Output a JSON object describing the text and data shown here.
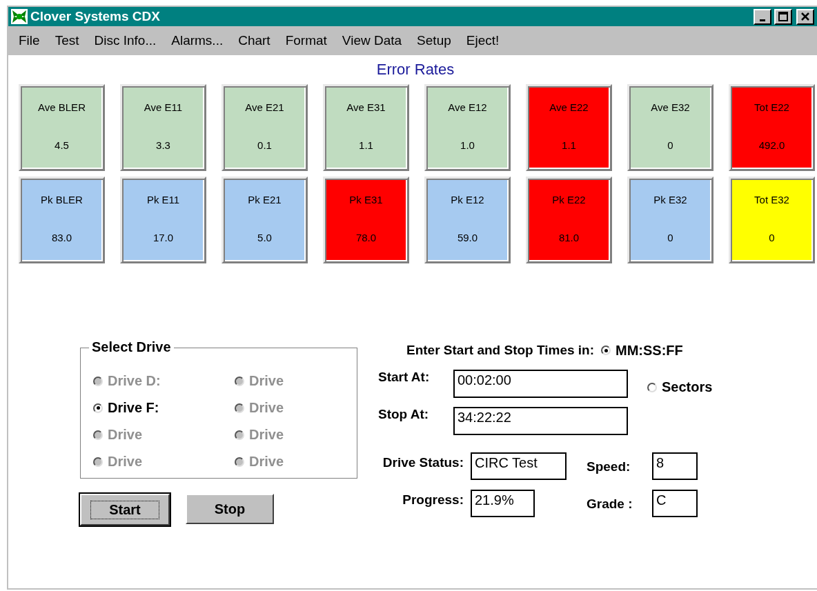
{
  "window": {
    "title": "Clover Systems CDX"
  },
  "menu": [
    "File",
    "Test",
    "Disc Info...",
    "Alarms...",
    "Chart",
    "Format",
    "View Data",
    "Setup",
    "Eject!"
  ],
  "error_rates": {
    "title": "Error Rates",
    "tiles": [
      {
        "label": "Ave BLER",
        "value": "4.5",
        "color": "#c0dcc0"
      },
      {
        "label": "Ave E11",
        "value": "3.3",
        "color": "#c0dcc0"
      },
      {
        "label": "Ave E21",
        "value": "0.1",
        "color": "#c0dcc0"
      },
      {
        "label": "Ave E31",
        "value": "1.1",
        "color": "#c0dcc0"
      },
      {
        "label": "Ave E12",
        "value": "1.0",
        "color": "#c0dcc0"
      },
      {
        "label": "Ave E22",
        "value": "1.1",
        "color": "#ff0000"
      },
      {
        "label": "Ave E32",
        "value": "0",
        "color": "#c0dcc0"
      },
      {
        "label": "Tot E22",
        "value": "492.0",
        "color": "#ff0000"
      },
      {
        "label": "Pk BLER",
        "value": "83.0",
        "color": "#a6caf0"
      },
      {
        "label": "Pk E11",
        "value": "17.0",
        "color": "#a6caf0"
      },
      {
        "label": "Pk E21",
        "value": "5.0",
        "color": "#a6caf0"
      },
      {
        "label": "Pk E31",
        "value": "78.0",
        "color": "#ff0000"
      },
      {
        "label": "Pk E12",
        "value": "59.0",
        "color": "#a6caf0"
      },
      {
        "label": "Pk E22",
        "value": "81.0",
        "color": "#ff0000"
      },
      {
        "label": "Pk E32",
        "value": "0",
        "color": "#a6caf0"
      },
      {
        "label": "Tot E32",
        "value": "0",
        "color": "#ffff00"
      }
    ]
  },
  "select_drive": {
    "title": "Select Drive",
    "drives": [
      {
        "label": "Drive D:",
        "selected": false,
        "disabled": true
      },
      {
        "label": "Drive",
        "selected": false,
        "disabled": true
      },
      {
        "label": "Drive F:",
        "selected": true,
        "disabled": false
      },
      {
        "label": "Drive",
        "selected": false,
        "disabled": true
      },
      {
        "label": "Drive",
        "selected": false,
        "disabled": true
      },
      {
        "label": "Drive",
        "selected": false,
        "disabled": true
      },
      {
        "label": "Drive",
        "selected": false,
        "disabled": true
      },
      {
        "label": "Drive",
        "selected": false,
        "disabled": true
      }
    ]
  },
  "buttons": [
    {
      "label": "Start",
      "focused": true
    },
    {
      "label": "Stop",
      "focused": false
    }
  ],
  "time_format": {
    "prompt": "Enter Start and Stop Times in:",
    "options": [
      {
        "label": "MM:SS:FF",
        "selected": true
      },
      {
        "label": "Sectors",
        "selected": false
      }
    ]
  },
  "start_at": {
    "label": "Start At:",
    "value": "00:02:00"
  },
  "stop_at": {
    "label": "Stop At:",
    "value": "34:22:22"
  },
  "drive_status": {
    "label": "Drive Status:",
    "value": "CIRC Test"
  },
  "speed": {
    "label": "Speed:",
    "value": "8"
  },
  "progress": {
    "label": "Progress:",
    "value": "21.9%"
  },
  "grade": {
    "label": "Grade :",
    "value": "C"
  }
}
